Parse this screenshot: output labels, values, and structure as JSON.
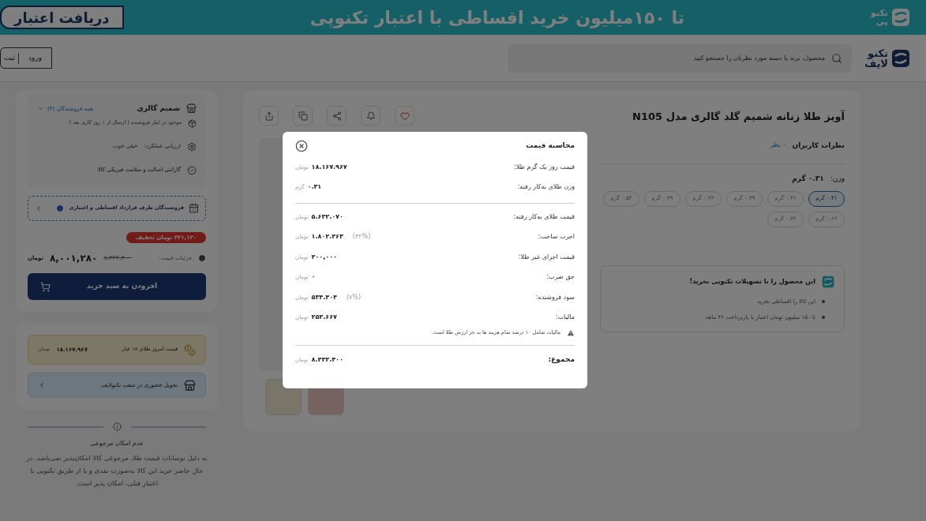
{
  "banner": {
    "logo_lines": [
      "تکنو",
      "پی"
    ],
    "text": "تا **۱۵۰میلیون** خرید اقساطی با اعتبار تکنوپی",
    "button": "دریافت اعتبار"
  },
  "header": {
    "logo_lines": [
      "تکنو",
      "لایف"
    ],
    "search": {
      "placeholder": "محصول، برند یا دسته مورد نظرتان را جستجو کنید"
    },
    "login": "ورود",
    "register": "ثبت"
  },
  "product": {
    "title": "آویز طلا زنانه شمیم گلد گالری مدل N105",
    "reviews": {
      "label": "نظرات کاربران",
      "count": "۰ نظر"
    },
    "weight": {
      "label": "وزن:",
      "value": "۰.۳۱ گرم"
    },
    "weights": [
      {
        "label": "۰.۳۱ گرم",
        "selected": true
      },
      {
        "label": "۰.۳۶ گرم",
        "selected": false
      },
      {
        "label": "۰.۳۹ گرم",
        "selected": false
      },
      {
        "label": "۰.۴۳ گرم",
        "selected": false
      },
      {
        "label": "۰.۴۹ گرم",
        "selected": false
      },
      {
        "label": "۰.۵۴ گرم",
        "selected": false
      },
      {
        "label": "۰.۶۶ گرم",
        "selected": false
      },
      {
        "label": "۰.۷۲ گرم",
        "selected": false
      }
    ],
    "offer": {
      "title": "این محصول را با تسهیلات تکنوپی بخرید!",
      "bullets": [
        "این کالا را اقساطی بخرید",
        "تا ۱۵۰ میلیون تومان اعتبار با بازپرداخت ۳۶ ماهه"
      ]
    }
  },
  "seller": {
    "name": "شمیم گالری",
    "all_sellers": "همه فروشندگان (۳)",
    "stock": "موجود در انبار فروشنده ( ارسال از ۱ روز کاری بعد )",
    "rating_label": "ارزیابی عملکرد:",
    "rating": "خیلی خوب",
    "guarantee": "گارانتی اصالت و سلامت فیزیکی کالا",
    "installment": "فروشندگان طرف قرارداد اقساطی و اعتباری",
    "discount": "۴۲۱,۱۲۰ تومان تخفیف",
    "price_details": "جزئیات قیمت:",
    "old_price": "۸,۴۲۲,۴۰۰",
    "price": "۸,۰۰۱,۲۸۰",
    "currency": "تومان",
    "add_to_cart": "افزودن به سبد خرید"
  },
  "gold_price": {
    "label": "قیمت امروز طلای ۱۸ عیار",
    "value": "۱۸.۱۶۷.۹۶۷",
    "unit": "تومان"
  },
  "delivery": "تحویل حضوری در شعب تکنولایف",
  "return_notice": {
    "title": "عدم امکان مرجوعی",
    "text": "به دلیل نوسانات قیمت طلا، مرجوعی کالا امکان‌پذیر نمی‌باشد. در حال حاضر خرید این کالا به‌صورت نقدی و یا از طریق تکنوپی با اعتبار قبلی، امکان پذیر است."
  },
  "modal": {
    "title": "محاسبه قیمت",
    "sections": [
      [
        {
          "label": "قیمت روز یک گرم طلا:",
          "value": "۱۸.۱۶۷.۹۶۷",
          "unit": "تومان"
        },
        {
          "label": "وزن طلای به‌کار رفته:",
          "value": "۰.۳۱",
          "unit": "گرم"
        }
      ],
      [
        {
          "label": "قیمت طلای به‌کار رفته:",
          "value": "۵.۶۳۲.۰۷۰",
          "unit": "تومان"
        },
        {
          "label": "اجرت ساخت:",
          "value": "۱.۸۰۲.۲۶۳",
          "percent": "(۳۲%)",
          "unit": "تومان"
        },
        {
          "label": "قیمت اجزای غیر طلا:",
          "value": "۲۰۰,۰۰۰",
          "unit": "تومان"
        },
        {
          "label": "حق ضرب:",
          "value": "۰",
          "unit": "تومان"
        },
        {
          "label": "سود فروشنده:",
          "value": "۵۳۴.۴۰۴",
          "percent": "(۷%)",
          "unit": "تومان"
        },
        {
          "label": "مالیات:",
          "value": "۲۵۳.۶۶۷",
          "unit": "تومان"
        }
      ]
    ],
    "note": "مالیات شامل ۱۰ درصد تمام هزینه ها به جز ارزش طلا است.",
    "total": {
      "label": "مجموع:",
      "value": "۸.۴۲۲.۴۰۰",
      "unit": "تومان"
    }
  }
}
